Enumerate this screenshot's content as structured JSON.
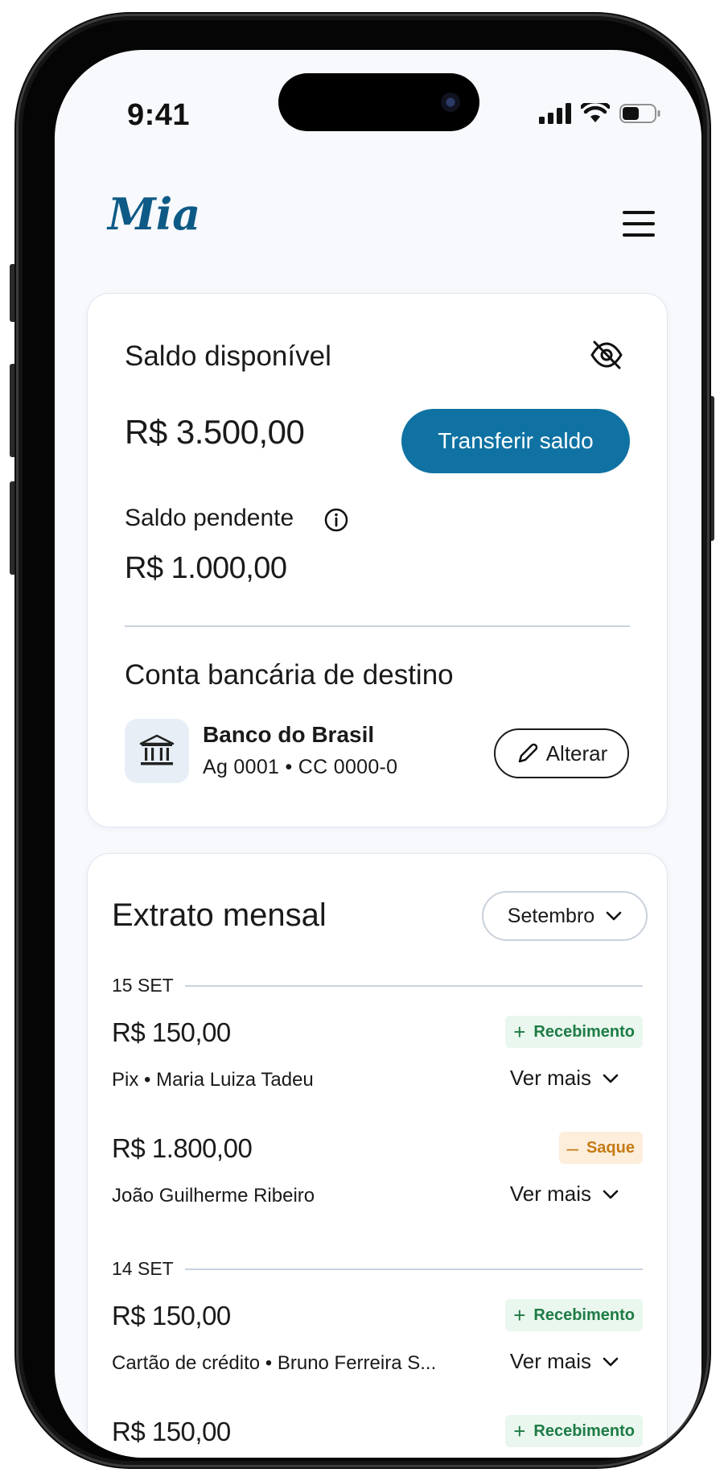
{
  "status_bar": {
    "time": "9:41"
  },
  "header": {
    "logo_text": "Mia"
  },
  "balance_card": {
    "available_label": "Saldo disponível",
    "available_amount": "R$ 3.500,00",
    "transfer_button": "Transferir saldo",
    "pending_label": "Saldo pendente",
    "pending_amount": "R$ 1.000,00",
    "destination_title": "Conta bancária de destino",
    "bank_name": "Banco do Brasil",
    "bank_account": "Ag 0001 • CC 0000-0",
    "change_button": "Alterar"
  },
  "statement": {
    "title": "Extrato mensal",
    "month": "Setembro",
    "groups": [
      {
        "date": "15 SET",
        "items": [
          {
            "amount": "R$ 150,00",
            "type": "Recebimento",
            "type_sign": "+",
            "desc": "Pix • Maria Luiza Tadeu",
            "more": "Ver mais"
          },
          {
            "amount": "R$ 1.800,00",
            "type": "Saque",
            "type_sign": "–",
            "desc": "João Guilherme Ribeiro",
            "more": "Ver mais"
          }
        ]
      },
      {
        "date": "14 SET",
        "items": [
          {
            "amount": "R$ 150,00",
            "type": "Recebimento",
            "type_sign": "+",
            "desc": "Cartão de crédito • Bruno Ferreira S...",
            "more": "Ver mais"
          },
          {
            "amount": "R$ 150,00",
            "type": "Recebimento",
            "type_sign": "+",
            "desc": "",
            "more": ""
          }
        ]
      }
    ]
  },
  "colors": {
    "brand": "#0f72a3",
    "logo": "#0e5a86",
    "income_bg": "#e9f7ee",
    "income_text": "#1e7b45",
    "withdraw_bg": "#fdeedc",
    "withdraw_text": "#c57a13"
  },
  "icons": [
    "signal-icon",
    "wifi-icon",
    "battery-icon",
    "menu-icon",
    "eye-off-icon",
    "info-icon",
    "bank-icon",
    "pencil-icon",
    "chevron-down-icon",
    "plus-icon",
    "minus-icon"
  ]
}
